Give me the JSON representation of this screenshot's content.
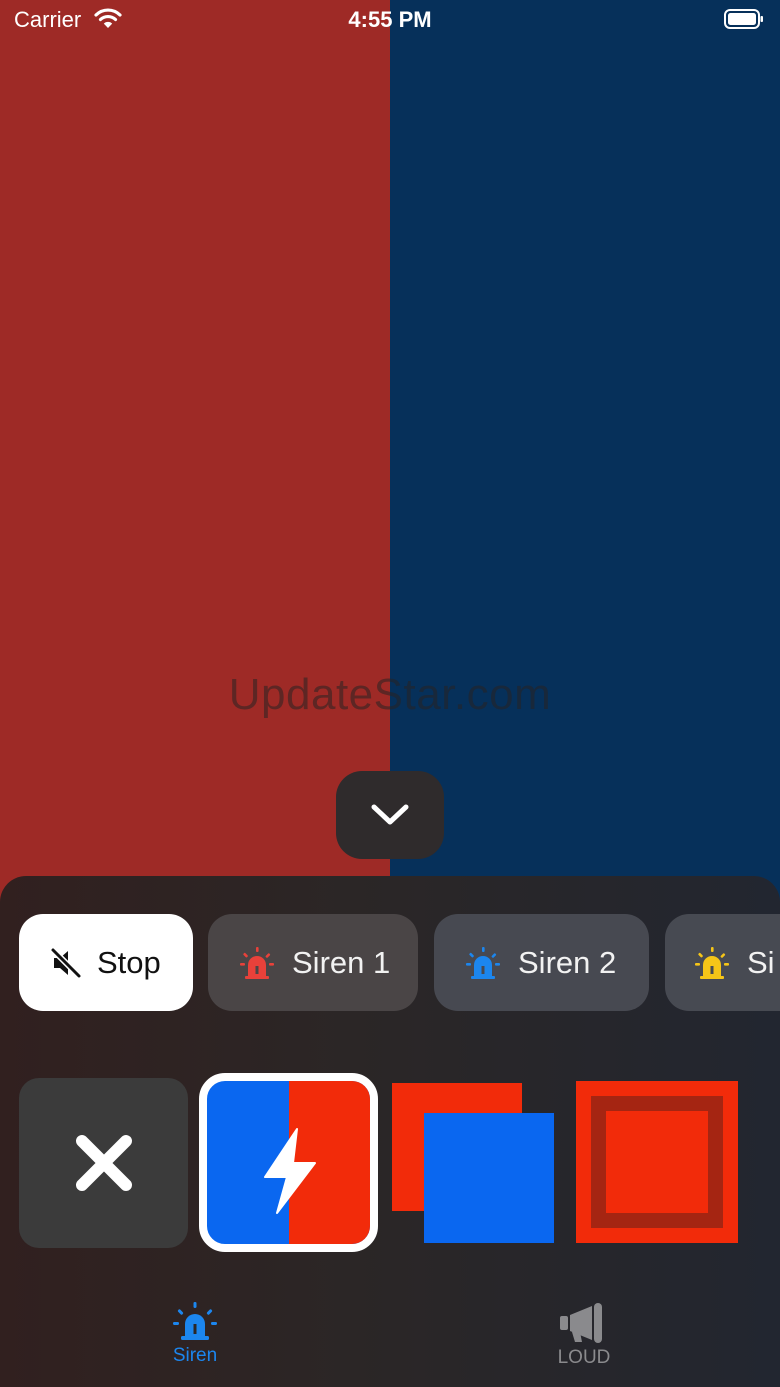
{
  "status_bar": {
    "carrier": "Carrier",
    "time": "4:55 PM"
  },
  "background": {
    "left_color": "#9e2a26",
    "right_color": "#06305a"
  },
  "watermark": "UpdateStar.com",
  "collapse_button": {
    "icon": "chevron-down-icon"
  },
  "sound_chips": [
    {
      "label": "Stop",
      "icon": "speaker-muted-icon",
      "selected": true
    },
    {
      "label": "Siren 1",
      "icon": "siren-icon",
      "icon_color": "#e8413a"
    },
    {
      "label": "Siren 2",
      "icon": "siren-icon",
      "icon_color": "#1c86ee"
    },
    {
      "label": "Si",
      "icon": "siren-icon",
      "icon_color": "#f5c518"
    }
  ],
  "light_modes": [
    {
      "name": "off",
      "icon": "close-icon"
    },
    {
      "name": "flash",
      "icon": "lightning-icon",
      "selected": true,
      "colors": [
        "#0a67f0",
        "#f22b0a"
      ]
    },
    {
      "name": "squares",
      "colors": [
        "#f22b0a",
        "#0a67f0"
      ]
    },
    {
      "name": "frame",
      "colors": [
        "#f22b0a",
        "#a52512"
      ]
    }
  ],
  "tab_bar": {
    "tabs": [
      {
        "label": "Siren",
        "icon": "siren-icon",
        "active": true,
        "color": "#1c86ee"
      },
      {
        "label": "LOUD",
        "icon": "megaphone-icon",
        "active": false,
        "color": "#8a8a8d"
      }
    ]
  }
}
